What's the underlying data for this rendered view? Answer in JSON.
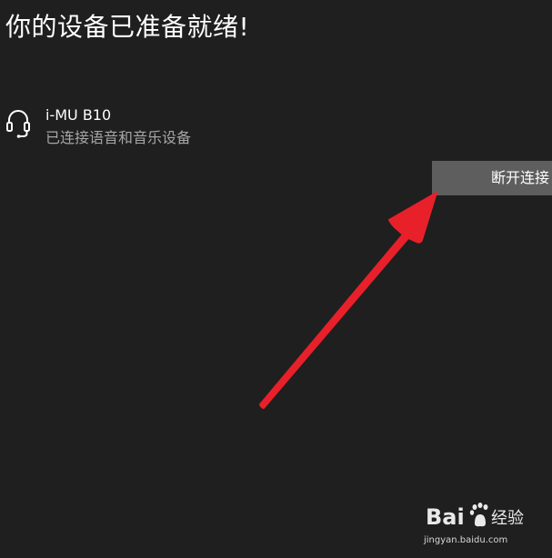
{
  "page": {
    "title": "你的设备已准备就绪!"
  },
  "device": {
    "icon": "headset-icon",
    "name": "i-MU B10",
    "status": "已连接语音和音乐设备"
  },
  "actions": {
    "disconnect_label": "断开连接"
  },
  "annotation": {
    "arrow_icon": "red-arrow-icon",
    "arrow_color": "#e8202a"
  },
  "watermark": {
    "logo_text": "Bai百经验",
    "url": "jingyan.baidu.com"
  },
  "colors": {
    "background": "#1f1f1f",
    "button_background": "#5e5e5e",
    "secondary_text": "#a6a6a6"
  }
}
